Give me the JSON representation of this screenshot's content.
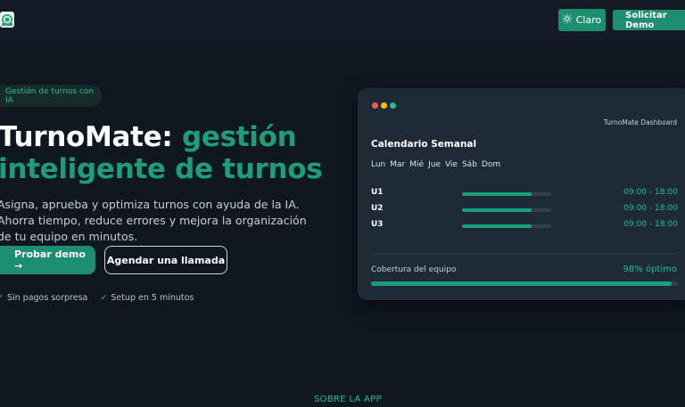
{
  "header": {
    "theme_button_label": "Claro",
    "theme_icon": "sun-icon",
    "demo_button_label": "Solicitar Demo",
    "logo_icon": "turnomate-logo-icon"
  },
  "hero": {
    "badge": "Gestión de turnos con IA",
    "title_plain": "TurnoMate: ",
    "title_accent": "gestión inteligente de turnos",
    "description": "Asigna, aprueba y optimiza turnos con ayuda de la IA. Ahorra tiempo, reduce errores y mejora la organización de tu equipo en minutos.",
    "primary_button": "Probar demo →",
    "secondary_button": "Agendar una llamada",
    "perks": [
      {
        "check": "✓",
        "label": "Sin pagos sorpresa"
      },
      {
        "check": "✓",
        "label": "Setup en 5 minutos"
      }
    ]
  },
  "dashboard": {
    "app_name": "TurnoMate Dashboard",
    "title": "Calendario Semanal",
    "days": [
      "Lun",
      "Mar",
      "Mié",
      "Jue",
      "Vie",
      "Sáb",
      "Dom"
    ],
    "rows": [
      {
        "label": "U1",
        "progress": 0.78,
        "time": "09:00 - 18:00"
      },
      {
        "label": "U2",
        "progress": 0.78,
        "time": "09:00 - 18:00"
      },
      {
        "label": "U3",
        "progress": 0.78,
        "time": "09:00 - 18:00"
      }
    ],
    "coverage_label": "Cobertura del equipo",
    "coverage_value": "98% óptimo",
    "coverage_progress": 0.98
  },
  "section": {
    "label": "SOBRE LA APP"
  },
  "colors": {
    "accent": "#1d8f70",
    "accent_text": "#1fbf8f",
    "background": "#0f1720",
    "card": "#1f2a37"
  }
}
